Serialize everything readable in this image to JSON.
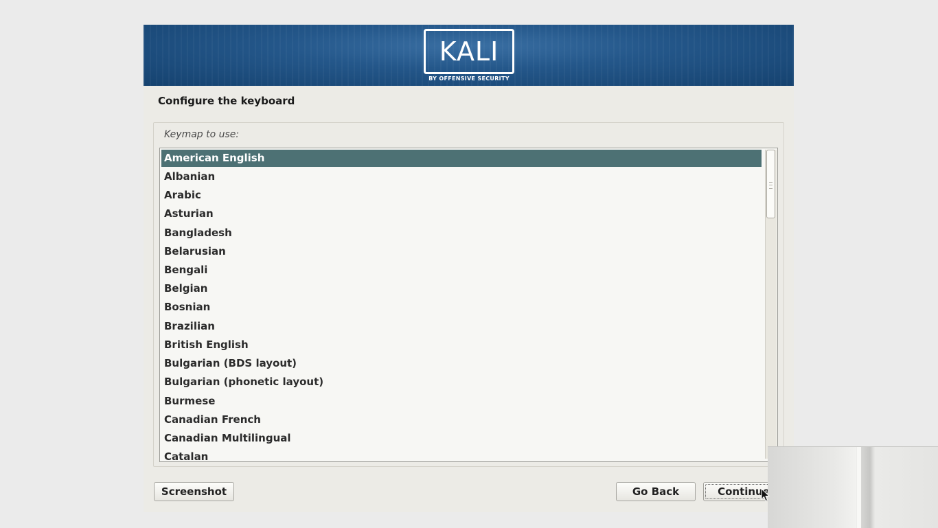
{
  "banner": {
    "logo_text": "KALI",
    "tagline": "BY OFFENSIVE SECURITY"
  },
  "page": {
    "title": "Configure the keyboard",
    "keymap_label": "Keymap to use:"
  },
  "keymap_list": {
    "selected_index": 0,
    "items": [
      "American English",
      "Albanian",
      "Arabic",
      "Asturian",
      "Bangladesh",
      "Belarusian",
      "Bengali",
      "Belgian",
      "Bosnian",
      "Brazilian",
      "British English",
      "Bulgarian (BDS layout)",
      "Bulgarian (phonetic layout)",
      "Burmese",
      "Canadian French",
      "Canadian Multilingual",
      "Catalan"
    ]
  },
  "buttons": {
    "screenshot": "Screenshot",
    "go_back": "Go Back",
    "continue": "Continue"
  },
  "colors": {
    "banner_blue": "#24578a",
    "selection": "#4d7174",
    "dialog_bg": "#ecebe6"
  }
}
